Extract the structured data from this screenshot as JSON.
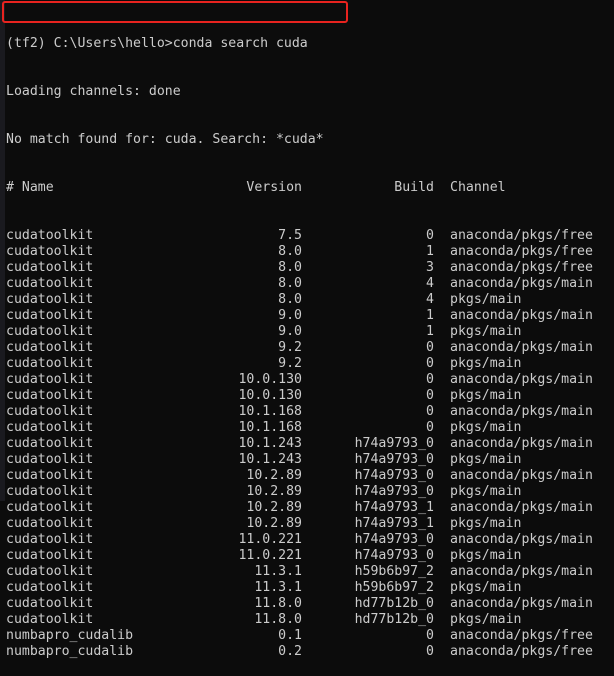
{
  "terminal": {
    "prompt": "(tf2) C:\\Users\\hello>",
    "command": "conda search cuda",
    "output_lines": [
      "Loading channels: done",
      "No match found for: cuda. Search: *cuda*"
    ],
    "header": {
      "name": "# Name",
      "version": "Version",
      "build": "Build",
      "channel": "Channel"
    },
    "rows": [
      {
        "name": "cudatoolkit",
        "version": "7.5",
        "build": "0",
        "channel": "anaconda/pkgs/free"
      },
      {
        "name": "cudatoolkit",
        "version": "8.0",
        "build": "1",
        "channel": "anaconda/pkgs/free"
      },
      {
        "name": "cudatoolkit",
        "version": "8.0",
        "build": "3",
        "channel": "anaconda/pkgs/free"
      },
      {
        "name": "cudatoolkit",
        "version": "8.0",
        "build": "4",
        "channel": "anaconda/pkgs/main"
      },
      {
        "name": "cudatoolkit",
        "version": "8.0",
        "build": "4",
        "channel": "pkgs/main"
      },
      {
        "name": "cudatoolkit",
        "version": "9.0",
        "build": "1",
        "channel": "anaconda/pkgs/main"
      },
      {
        "name": "cudatoolkit",
        "version": "9.0",
        "build": "1",
        "channel": "pkgs/main"
      },
      {
        "name": "cudatoolkit",
        "version": "9.2",
        "build": "0",
        "channel": "anaconda/pkgs/main"
      },
      {
        "name": "cudatoolkit",
        "version": "9.2",
        "build": "0",
        "channel": "pkgs/main"
      },
      {
        "name": "cudatoolkit",
        "version": "10.0.130",
        "build": "0",
        "channel": "anaconda/pkgs/main"
      },
      {
        "name": "cudatoolkit",
        "version": "10.0.130",
        "build": "0",
        "channel": "pkgs/main"
      },
      {
        "name": "cudatoolkit",
        "version": "10.1.168",
        "build": "0",
        "channel": "anaconda/pkgs/main"
      },
      {
        "name": "cudatoolkit",
        "version": "10.1.168",
        "build": "0",
        "channel": "pkgs/main"
      },
      {
        "name": "cudatoolkit",
        "version": "10.1.243",
        "build": "h74a9793_0",
        "channel": "anaconda/pkgs/main"
      },
      {
        "name": "cudatoolkit",
        "version": "10.1.243",
        "build": "h74a9793_0",
        "channel": "pkgs/main"
      },
      {
        "name": "cudatoolkit",
        "version": "10.2.89",
        "build": "h74a9793_0",
        "channel": "anaconda/pkgs/main"
      },
      {
        "name": "cudatoolkit",
        "version": "10.2.89",
        "build": "h74a9793_0",
        "channel": "pkgs/main"
      },
      {
        "name": "cudatoolkit",
        "version": "10.2.89",
        "build": "h74a9793_1",
        "channel": "anaconda/pkgs/main"
      },
      {
        "name": "cudatoolkit",
        "version": "10.2.89",
        "build": "h74a9793_1",
        "channel": "pkgs/main"
      },
      {
        "name": "cudatoolkit",
        "version": "11.0.221",
        "build": "h74a9793_0",
        "channel": "anaconda/pkgs/main"
      },
      {
        "name": "cudatoolkit",
        "version": "11.0.221",
        "build": "h74a9793_0",
        "channel": "pkgs/main"
      },
      {
        "name": "cudatoolkit",
        "version": "11.3.1",
        "build": "h59b6b97_2",
        "channel": "anaconda/pkgs/main"
      },
      {
        "name": "cudatoolkit",
        "version": "11.3.1",
        "build": "h59b6b97_2",
        "channel": "pkgs/main"
      },
      {
        "name": "cudatoolkit",
        "version": "11.8.0",
        "build": "hd77b12b_0",
        "channel": "anaconda/pkgs/main"
      },
      {
        "name": "cudatoolkit",
        "version": "11.8.0",
        "build": "hd77b12b_0",
        "channel": "pkgs/main"
      },
      {
        "name": "numbapro_cudalib",
        "version": "0.1",
        "build": "0",
        "channel": "anaconda/pkgs/free"
      },
      {
        "name": "numbapro_cudalib",
        "version": "0.2",
        "build": "0",
        "channel": "anaconda/pkgs/free"
      }
    ]
  },
  "colors": {
    "background": "#0c0c0c",
    "text": "#cccccc",
    "highlight_border": "#e8231f"
  }
}
